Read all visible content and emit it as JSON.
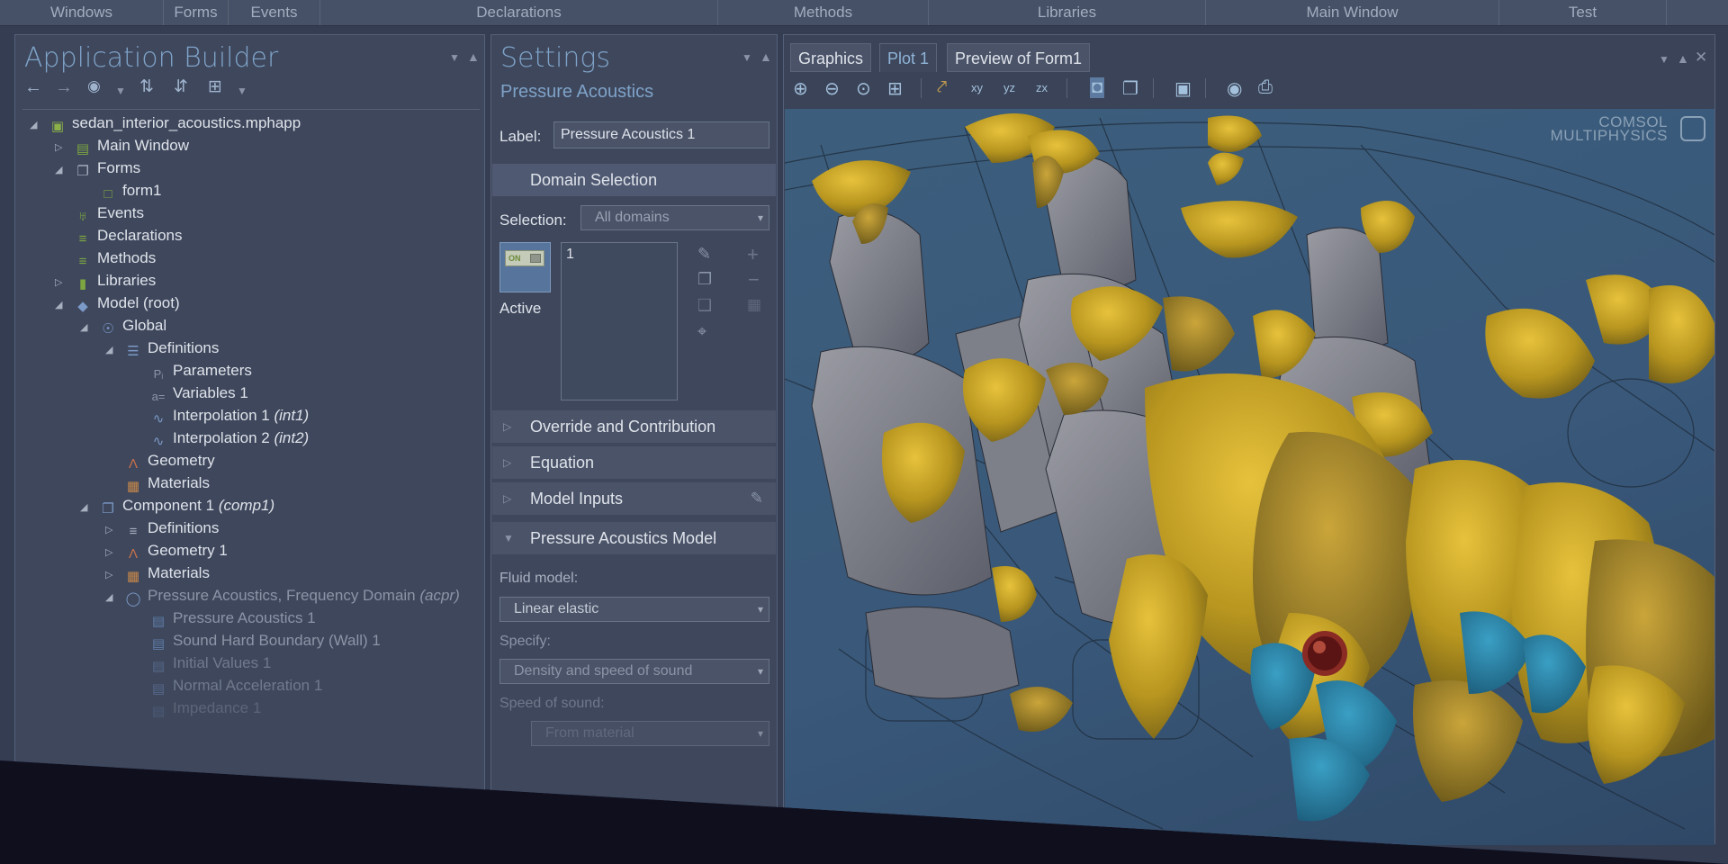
{
  "ribbon": {
    "tabs": [
      "Windows",
      "Forms",
      "Events",
      "Declarations",
      "Methods",
      "Libraries",
      "Main Window",
      "Test"
    ]
  },
  "app_builder": {
    "title": "Application Builder",
    "tree": [
      {
        "label": "sedan_interior_acoustics.mphapp",
        "icon": "app-icon"
      },
      {
        "label": "Main Window",
        "icon": "window-icon"
      },
      {
        "label": "Forms",
        "icon": "forms-icon"
      },
      {
        "label": "form1",
        "icon": "form-icon"
      },
      {
        "label": "Events",
        "icon": "events-icon"
      },
      {
        "label": "Declarations",
        "icon": "declarations-icon"
      },
      {
        "label": "Methods",
        "icon": "methods-icon"
      },
      {
        "label": "Libraries",
        "icon": "libraries-icon"
      },
      {
        "label": "Model (root)",
        "icon": "model-icon"
      },
      {
        "label": "Global",
        "icon": "globe-icon"
      },
      {
        "label": "Definitions",
        "icon": "definitions-icon"
      },
      {
        "label": "Parameters",
        "icon": "parameters-icon"
      },
      {
        "label": "Variables 1",
        "icon": "variables-icon"
      },
      {
        "label": "Interpolation 1",
        "suffix": "(int1)",
        "icon": "interpolation-icon"
      },
      {
        "label": "Interpolation 2",
        "suffix": "(int2)",
        "icon": "interpolation-icon"
      },
      {
        "label": "Geometry",
        "icon": "geometry-icon"
      },
      {
        "label": "Materials",
        "icon": "materials-icon"
      },
      {
        "label": "Component 1",
        "suffix": "(comp1)",
        "icon": "component-icon"
      },
      {
        "label": "Definitions",
        "icon": "definitions-icon"
      },
      {
        "label": "Geometry 1",
        "icon": "geometry-icon"
      },
      {
        "label": "Materials",
        "icon": "materials-icon"
      },
      {
        "label": "Pressure Acoustics, Frequency Domain",
        "suffix": "(acpr)",
        "icon": "physics-icon"
      },
      {
        "label": "Pressure Acoustics 1",
        "icon": "feature-icon"
      },
      {
        "label": "Sound Hard Boundary (Wall) 1",
        "icon": "feature-icon"
      },
      {
        "label": "Initial Values 1",
        "icon": "feature-icon"
      },
      {
        "label": "Normal Acceleration 1",
        "icon": "feature-icon"
      },
      {
        "label": "Impedance 1",
        "icon": "feature-icon"
      }
    ]
  },
  "settings": {
    "title": "Settings",
    "subtitle": "Pressure Acoustics",
    "label_caption": "Label:",
    "label_value": "Pressure Acoustics 1",
    "domain_selection": "Domain Selection",
    "selection_caption": "Selection:",
    "selection_value": "All domains",
    "toggle_text": "ON",
    "active_label": "Active",
    "selection_list": [
      "1"
    ],
    "sections": [
      "Override and Contribution",
      "Equation",
      "Model Inputs",
      "Pressure Acoustics Model"
    ],
    "fluid_model_caption": "Fluid model:",
    "fluid_model_value": "Linear elastic",
    "specify_caption": "Specify:",
    "specify_value": "Density and speed of sound",
    "speed_caption": "Speed of sound:",
    "speed_value": "From material"
  },
  "graphics": {
    "tabs": [
      "Graphics",
      "Plot 1",
      "Preview of Form1"
    ],
    "active_tab": "Plot 1",
    "logo_line1": "COMSOL",
    "logo_line2": "MULTIPHYSICS",
    "colors": {
      "isosurface": "#c9a62b",
      "isosurface_blue": "#2f8fb5",
      "seat": "#8e8f96",
      "background": "#3c5e7c"
    }
  }
}
